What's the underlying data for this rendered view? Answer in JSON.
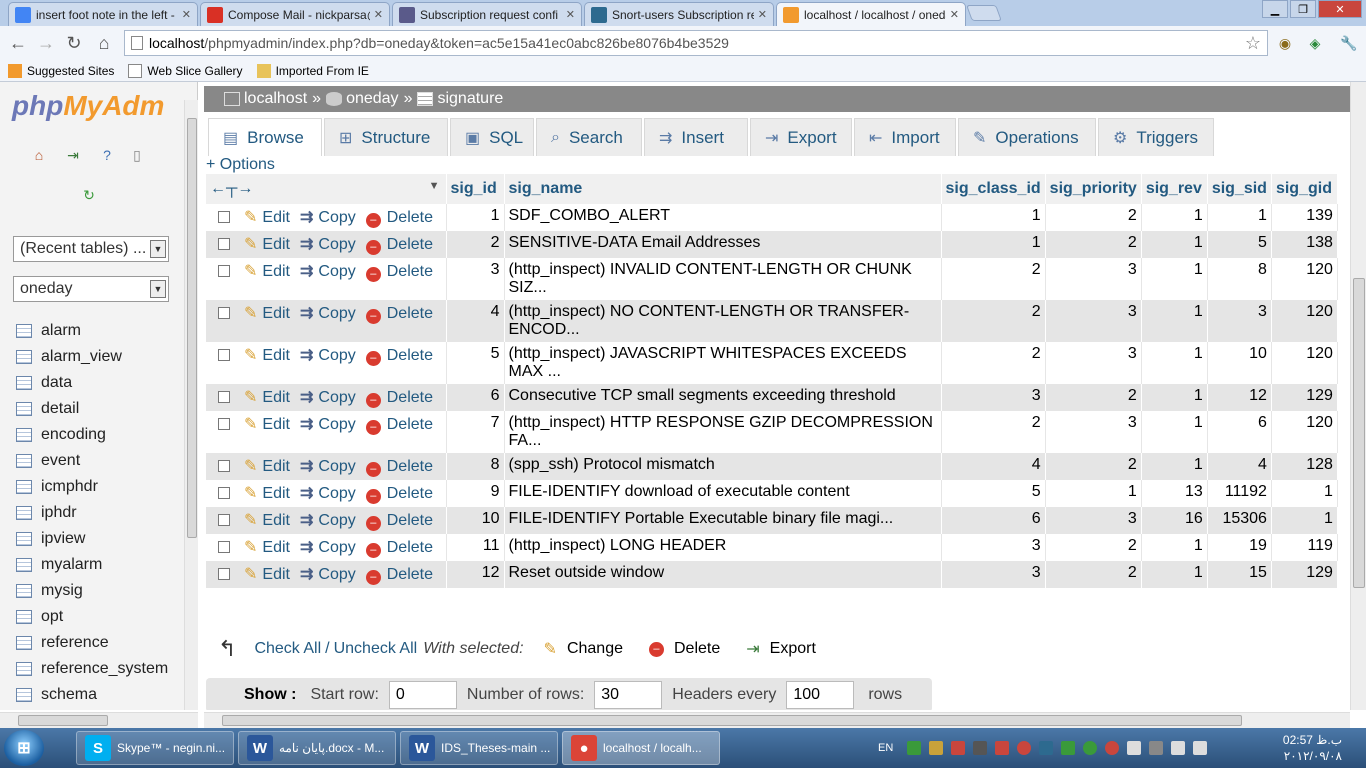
{
  "browser": {
    "tabs": [
      {
        "title": "insert foot note in the left - ",
        "favicon": "google-icon",
        "color": "#4285f4"
      },
      {
        "title": "Compose Mail - nickparsa@",
        "favicon": "gmail-icon",
        "color": "#d93025"
      },
      {
        "title": "Subscription request confi",
        "favicon": "mailman-icon",
        "color": "#5a5a8a"
      },
      {
        "title": "Snort-users Subscription re",
        "favicon": "sourceforge-icon",
        "color": "#2d6a8f"
      },
      {
        "title": "localhost / localhost / oneda",
        "favicon": "pma-icon",
        "color": "#f29a2e"
      }
    ],
    "url_host": "localhost",
    "url_path": "/phpmyadmin/index.php?db=oneday&token=ac5e15a41ec0abc826be8076b4be3529",
    "bookmarks": [
      "Suggested Sites",
      "Web Slice Gallery",
      "Imported From IE"
    ]
  },
  "nav": {
    "logo_php": "php",
    "logo_myadmin": "MyAdm",
    "recent_tables": "(Recent tables) ...",
    "db_select": "oneday",
    "tables": [
      "alarm",
      "alarm_view",
      "data",
      "detail",
      "encoding",
      "event",
      "icmphdr",
      "iphdr",
      "ipview",
      "myalarm",
      "mysig",
      "opt",
      "reference",
      "reference_system",
      "schema"
    ]
  },
  "breadcrumb": {
    "server": "localhost",
    "database": "oneday",
    "table": "signature",
    "separator": "»"
  },
  "tabs": [
    {
      "label": "Browse",
      "icon": "browse-icon",
      "glyph": "▤"
    },
    {
      "label": "Structure",
      "icon": "structure-icon",
      "glyph": "⊞"
    },
    {
      "label": "SQL",
      "icon": "sql-icon",
      "glyph": "▣"
    },
    {
      "label": "Search",
      "icon": "search-icon",
      "glyph": "⌕"
    },
    {
      "label": "Insert",
      "icon": "insert-icon",
      "glyph": "⇉"
    },
    {
      "label": "Export",
      "icon": "export-icon",
      "glyph": "⇥"
    },
    {
      "label": "Import",
      "icon": "import-icon",
      "glyph": "⇤"
    },
    {
      "label": "Operations",
      "icon": "operations-icon",
      "glyph": "✎"
    },
    {
      "label": "Triggers",
      "icon": "triggers-icon",
      "glyph": "⚙"
    }
  ],
  "options_label": "+ Options",
  "table": {
    "nav_arrows": "←┬→",
    "columns": [
      "sig_id",
      "sig_name",
      "sig_class_id",
      "sig_priority",
      "sig_rev",
      "sig_sid",
      "sig_gid"
    ],
    "action_labels": {
      "edit": "Edit",
      "copy": "Copy",
      "delete": "Delete"
    },
    "rows": [
      {
        "sig_id": "1",
        "sig_name": "SDF_COMBO_ALERT",
        "sig_class_id": "1",
        "sig_priority": "2",
        "sig_rev": "1",
        "sig_sid": "1",
        "sig_gid": "139"
      },
      {
        "sig_id": "2",
        "sig_name": "SENSITIVE-DATA Email Addresses",
        "sig_class_id": "1",
        "sig_priority": "2",
        "sig_rev": "1",
        "sig_sid": "5",
        "sig_gid": "138"
      },
      {
        "sig_id": "3",
        "sig_name": "(http_inspect) INVALID CONTENT-LENGTH OR CHUNK SIZ...",
        "sig_class_id": "2",
        "sig_priority": "3",
        "sig_rev": "1",
        "sig_sid": "8",
        "sig_gid": "120"
      },
      {
        "sig_id": "4",
        "sig_name": "(http_inspect) NO CONTENT-LENGTH OR TRANSFER-ENCOD...",
        "sig_class_id": "2",
        "sig_priority": "3",
        "sig_rev": "1",
        "sig_sid": "3",
        "sig_gid": "120"
      },
      {
        "sig_id": "5",
        "sig_name": "(http_inspect) JAVASCRIPT WHITESPACES EXCEEDS MAX ...",
        "sig_class_id": "2",
        "sig_priority": "3",
        "sig_rev": "1",
        "sig_sid": "10",
        "sig_gid": "120"
      },
      {
        "sig_id": "6",
        "sig_name": "Consecutive TCP small segments exceeding threshold",
        "sig_class_id": "3",
        "sig_priority": "2",
        "sig_rev": "1",
        "sig_sid": "12",
        "sig_gid": "129"
      },
      {
        "sig_id": "7",
        "sig_name": "(http_inspect) HTTP RESPONSE GZIP DECOMPRESSION FA...",
        "sig_class_id": "2",
        "sig_priority": "3",
        "sig_rev": "1",
        "sig_sid": "6",
        "sig_gid": "120"
      },
      {
        "sig_id": "8",
        "sig_name": "(spp_ssh) Protocol mismatch",
        "sig_class_id": "4",
        "sig_priority": "2",
        "sig_rev": "1",
        "sig_sid": "4",
        "sig_gid": "128"
      },
      {
        "sig_id": "9",
        "sig_name": "FILE-IDENTIFY download of executable content",
        "sig_class_id": "5",
        "sig_priority": "1",
        "sig_rev": "13",
        "sig_sid": "11192",
        "sig_gid": "1"
      },
      {
        "sig_id": "10",
        "sig_name": "FILE-IDENTIFY Portable Executable binary file magi...",
        "sig_class_id": "6",
        "sig_priority": "3",
        "sig_rev": "16",
        "sig_sid": "15306",
        "sig_gid": "1"
      },
      {
        "sig_id": "11",
        "sig_name": "(http_inspect) LONG HEADER",
        "sig_class_id": "3",
        "sig_priority": "2",
        "sig_rev": "1",
        "sig_sid": "19",
        "sig_gid": "119"
      },
      {
        "sig_id": "12",
        "sig_name": "Reset outside window",
        "sig_class_id": "3",
        "sig_priority": "2",
        "sig_rev": "1",
        "sig_sid": "15",
        "sig_gid": "129"
      }
    ]
  },
  "with_selected": {
    "check_all": "Check All",
    "uncheck_all": "Uncheck All",
    "label": "With selected:",
    "change": "Change",
    "delete": "Delete",
    "export": "Export"
  },
  "navform": {
    "show": "Show :",
    "start_row_label": "Start row:",
    "start_row": "0",
    "rows_label": "Number of rows:",
    "rows": "30",
    "headers_label": "Headers every",
    "headers": "100",
    "rows_suffix": "rows"
  },
  "taskbar": {
    "tasks": [
      {
        "label": "Skype™ - negin.ni...",
        "icon": "skype-icon",
        "glyph": "S",
        "color": "#00aff0"
      },
      {
        "label": "پایان نامه.docx - M...",
        "icon": "word-icon",
        "glyph": "W",
        "color": "#2b579a"
      },
      {
        "label": "IDS_Theses-main ...",
        "icon": "word-icon",
        "glyph": "W",
        "color": "#2b579a"
      },
      {
        "label": "localhost / localh...",
        "icon": "chrome-icon",
        "glyph": "●",
        "color": "#db4437"
      }
    ],
    "lang": "EN",
    "time": "02:57 ب.ظ",
    "date": "۲۰۱۲/۰۹/۰۸"
  }
}
